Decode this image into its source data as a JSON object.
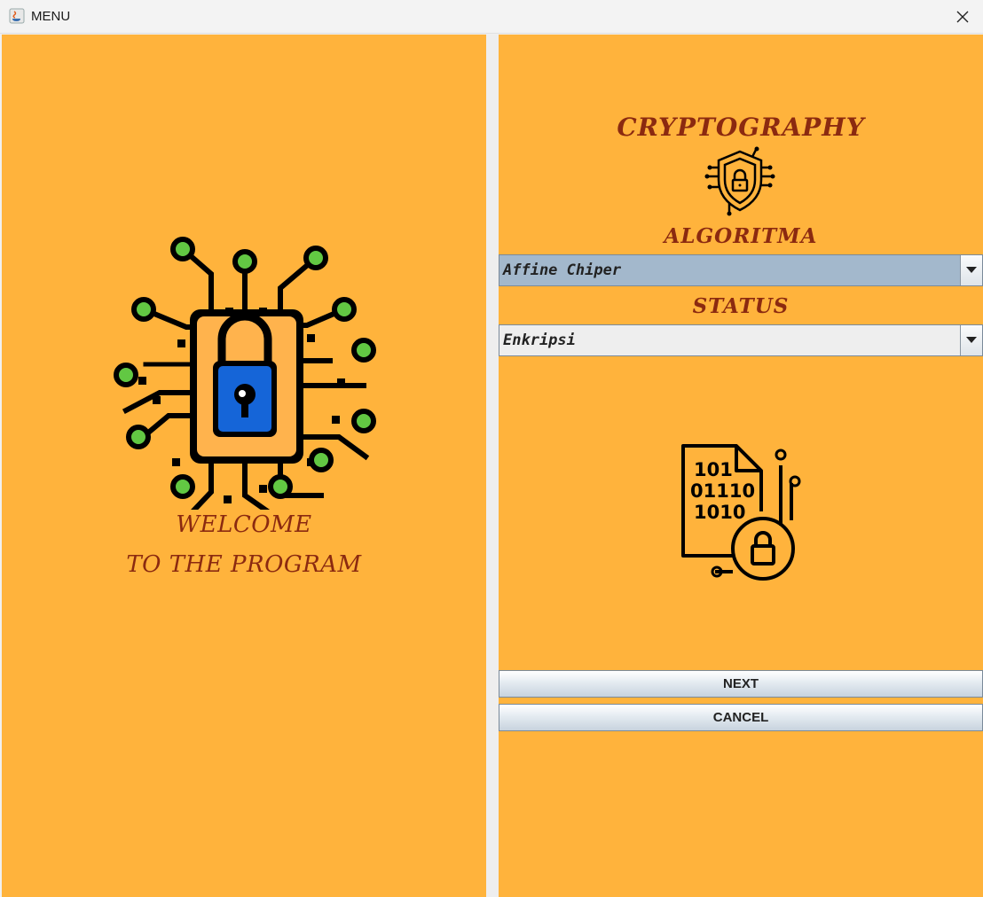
{
  "window": {
    "title": "MENU"
  },
  "left": {
    "welcome_line1": "WELCOME",
    "welcome_line2": "TO THE PROGRAM"
  },
  "right": {
    "title": "CRYPTOGRAPHY",
    "algorithm_label": "ALGORITMA",
    "algorithm_selected": "Affine Chiper",
    "status_label": "STATUS",
    "status_selected": "Enkripsi"
  },
  "buttons": {
    "next": "NEXT",
    "cancel": "CANCEL"
  },
  "data_icon_bits": {
    "line1": "101",
    "line2": "01110",
    "line3": "1010"
  },
  "colors": {
    "panel": "#ffb33c",
    "heading": "#8b2a10",
    "combo_active": "#a3b8cc",
    "combo_inactive": "#eeeeee",
    "lock_blue": "#1565d8",
    "node_green": "#62c843"
  }
}
